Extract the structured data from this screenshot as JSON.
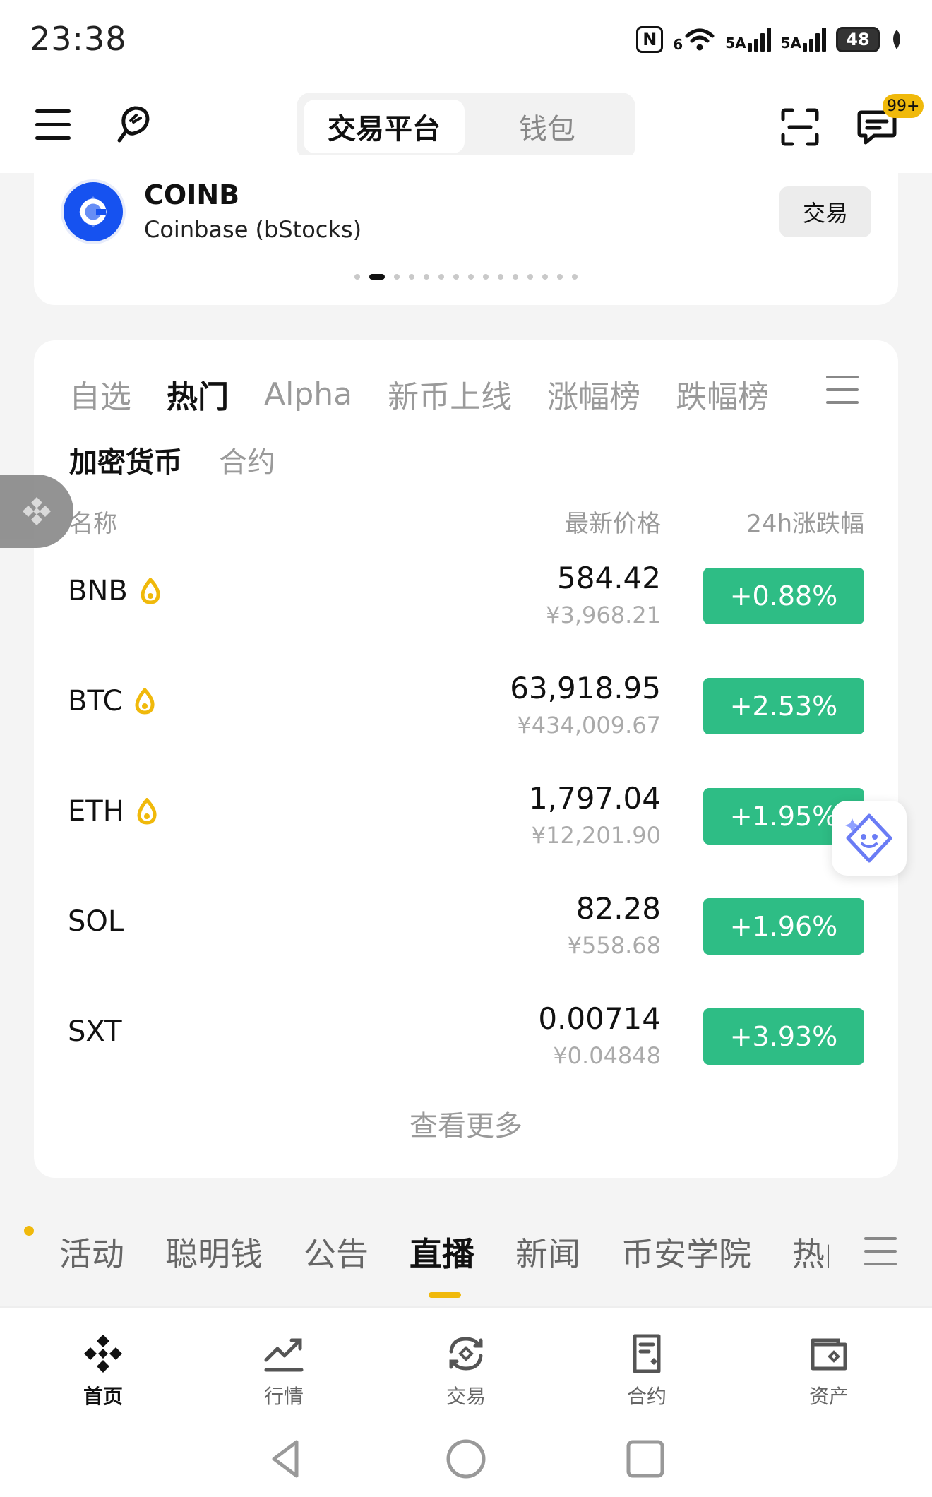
{
  "status_bar": {
    "time": "23:38",
    "network1": "6",
    "network2": "5A",
    "network3": "5A",
    "battery": "48",
    "nfc": "N"
  },
  "header": {
    "segment_active": "交易平台",
    "segment_inactive": "钱包",
    "notification_badge": "99+",
    "icons": [
      "menu-icon",
      "pin-icon",
      "scan-icon",
      "message-icon"
    ]
  },
  "featured_coin": {
    "symbol": "COINB",
    "name": "Coinbase (bStocks)",
    "trade_label": "交易",
    "logo_letter": "C",
    "carousel_total": 15,
    "carousel_active": 1
  },
  "market": {
    "tabs": [
      "自选",
      "热门",
      "Alpha",
      "新币上线",
      "涨幅榜",
      "跌幅榜"
    ],
    "active_tab": "热门",
    "subtabs": [
      "加密货币",
      "合约"
    ],
    "active_subtab": "加密货币",
    "columns": {
      "name": "名称",
      "price": "最新价格",
      "change": "24h涨跌幅"
    },
    "rows": [
      {
        "symbol": "BNB",
        "hot": true,
        "price": "584.42",
        "cny": "¥3,968.21",
        "change": "+0.88%"
      },
      {
        "symbol": "BTC",
        "hot": true,
        "price": "63,918.95",
        "cny": "¥434,009.67",
        "change": "+2.53%"
      },
      {
        "symbol": "ETH",
        "hot": true,
        "price": "1,797.04",
        "cny": "¥12,201.90",
        "change": "+1.95%"
      },
      {
        "symbol": "SOL",
        "hot": false,
        "price": "82.28",
        "cny": "¥558.68",
        "change": "+1.96%"
      },
      {
        "symbol": "SXT",
        "hot": false,
        "price": "0.00714",
        "cny": "¥0.04848",
        "change": "+3.93%"
      }
    ],
    "see_more": "查看更多"
  },
  "news_tabs": {
    "items": [
      "活动",
      "聪明钱",
      "公告",
      "直播",
      "新闻",
      "币安学院"
    ],
    "truncated": "热门",
    "active": "直播"
  },
  "bottom_nav": {
    "items": [
      {
        "label": "首页",
        "icon": "home-icon",
        "active": true
      },
      {
        "label": "行情",
        "icon": "markets-icon",
        "active": false
      },
      {
        "label": "交易",
        "icon": "trade-icon",
        "active": false
      },
      {
        "label": "合约",
        "icon": "futures-icon",
        "active": false
      },
      {
        "label": "资产",
        "icon": "assets-icon",
        "active": false
      }
    ]
  },
  "colors": {
    "brand_yellow": "#f0b90b",
    "up_green": "#2ebd85",
    "coinbase_blue": "#1652f0",
    "ai_accent": "#6a7cf5"
  }
}
